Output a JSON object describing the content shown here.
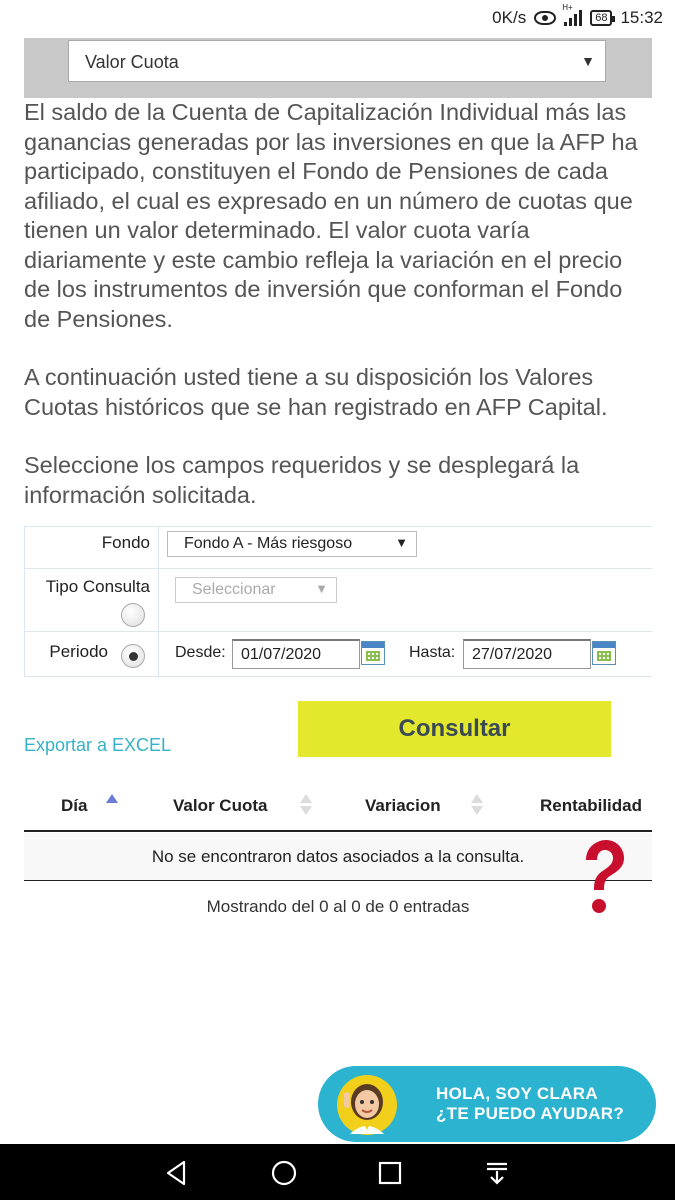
{
  "status_bar": {
    "speed": "0K/s",
    "network": "H+",
    "battery": "68",
    "time": "15:32"
  },
  "top_select": {
    "value": "Valor Cuota"
  },
  "paragraphs": {
    "p1": [
      "El saldo de la Cuenta de Capitalización Individual más las",
      "ganancias generadas por las inversiones en que la AFP ha",
      "participado, constituyen el Fondo de Pensiones de cada",
      "afiliado, el cual es expresado en un número de cuotas que",
      "tienen un valor determinado. El valor cuota varía",
      "diariamente y este cambio refleja la variación en el precio",
      "de los instrumentos de inversión que conforman el Fondo",
      "de Pensiones."
    ],
    "p2": [
      "A continuación usted tiene a su disposición los Valores",
      "Cuotas históricos que se han registrado en AFP Capital."
    ],
    "p3": [
      "Seleccione los campos requeridos y se desplegará la",
      "información solicitada."
    ]
  },
  "form": {
    "fondo_label": "Fondo",
    "fondo_value": "Fondo A - Más riesgoso",
    "tipo_label": "Tipo Consulta",
    "tipo_value": "Seleccionar",
    "periodo_label": "Periodo",
    "desde_label": "Desde:",
    "desde_value": "01/07/2020",
    "hasta_label": "Hasta:",
    "hasta_value": "27/07/2020"
  },
  "actions": {
    "export_label": "Exportar a EXCEL",
    "consultar_label": "Consultar"
  },
  "results": {
    "columns": [
      "Día",
      "Valor Cuota",
      "Variacion",
      "Rentabilidad"
    ],
    "empty_message": "No se encontraron datos asociados a la consulta.",
    "showing": "Mostrando del 0 al 0 de 0 entradas"
  },
  "chat": {
    "line1": "HOLA, SOY CLARA",
    "line2": "¿TE PUEDO AYUDAR?"
  },
  "colors": {
    "accent_teal": "#2bb3cf",
    "button_yellow": "#e3e82c",
    "help_red": "#c8102e"
  }
}
